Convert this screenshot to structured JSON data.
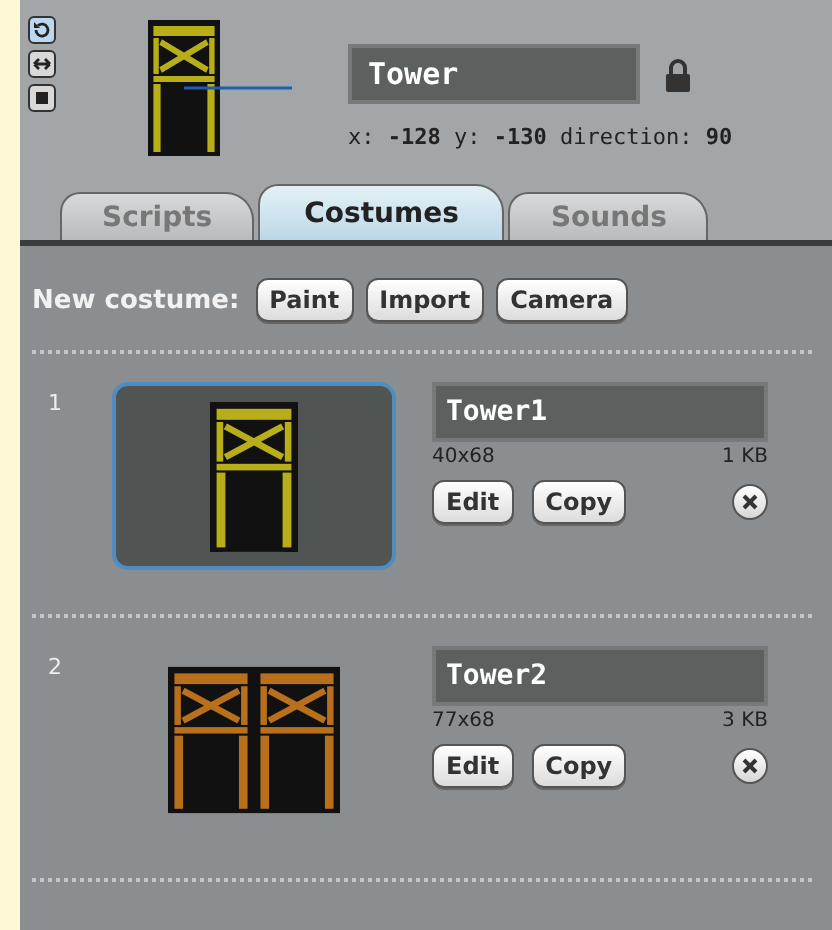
{
  "sprite": {
    "name": "Tower",
    "coordinates": "x: **-128** y: **-130** direction: **90**"
  },
  "rotation_styles": [
    {
      "kind": "rotate",
      "selected": true
    },
    {
      "kind": "flip",
      "selected": false
    },
    {
      "kind": "none",
      "selected": false
    }
  ],
  "tabs": [
    {
      "label": "Scripts",
      "selected": false
    },
    {
      "label": "Costumes",
      "selected": true
    },
    {
      "label": "Sounds",
      "selected": false
    }
  ],
  "new_costume": {
    "label": "New costume:",
    "buttons": [
      "Paint",
      "Import",
      "Camera"
    ]
  },
  "costumes": [
    {
      "number": "1",
      "name": "Tower1",
      "size": "40x68",
      "file_size": "1 KB",
      "selected": true,
      "buttons": [
        "Edit",
        "Copy"
      ]
    },
    {
      "number": "2",
      "name": "Tower2",
      "size": "77x68",
      "file_size": "3 KB",
      "selected": false,
      "buttons": [
        "Edit",
        "Copy"
      ]
    }
  ]
}
